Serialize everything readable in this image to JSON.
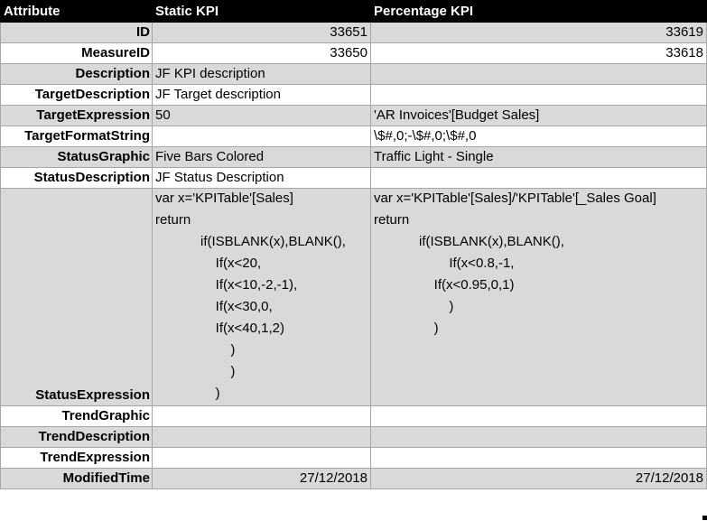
{
  "header": {
    "col1": "Attribute",
    "col2": "Static KPI",
    "col3": "Percentage KPI"
  },
  "rows": {
    "id": {
      "label": "ID",
      "static": "33651",
      "percentage": "33619"
    },
    "measure_id": {
      "label": "MeasureID",
      "static": "33650",
      "percentage": "33618"
    },
    "description": {
      "label": "Description",
      "static": "JF KPI description",
      "percentage": ""
    },
    "target_description": {
      "label": "TargetDescription",
      "static": "JF Target description",
      "percentage": ""
    },
    "target_expression": {
      "label": "TargetExpression",
      "static": "50",
      "percentage": "'AR Invoices'[Budget Sales]"
    },
    "target_format_string": {
      "label": "TargetFormatString",
      "static": "",
      "percentage": "\\$#,0;-\\$#,0;\\$#,0"
    },
    "status_graphic": {
      "label": "StatusGraphic",
      "static": "Five Bars Colored",
      "percentage": "Traffic Light - Single"
    },
    "status_description": {
      "label": "StatusDescription",
      "static": "JF Status Description",
      "percentage": ""
    },
    "status_expression": {
      "label": "StatusExpression",
      "static": [
        "var x='KPITable'[Sales]",
        "return",
        "            if(ISBLANK(x),BLANK(),",
        "                If(x<20,",
        "                If(x<10,-2,-1),",
        "                If(x<30,0,",
        "                If(x<40,1,2)",
        "                    )",
        "                    )",
        "                )"
      ],
      "percentage": [
        "var x='KPITable'[Sales]/'KPITable'[_Sales Goal]",
        "return",
        "            if(ISBLANK(x),BLANK(),",
        "                    If(x<0.8,-1,",
        "                If(x<0.95,0,1)",
        "                    )",
        "                )"
      ]
    },
    "trend_graphic": {
      "label": "TrendGraphic",
      "static": "",
      "percentage": ""
    },
    "trend_description": {
      "label": "TrendDescription",
      "static": "",
      "percentage": ""
    },
    "trend_expression": {
      "label": "TrendExpression",
      "static": "",
      "percentage": ""
    },
    "modified_time": {
      "label": "ModifiedTime",
      "static": "27/12/2018",
      "percentage": "27/12/2018"
    }
  }
}
